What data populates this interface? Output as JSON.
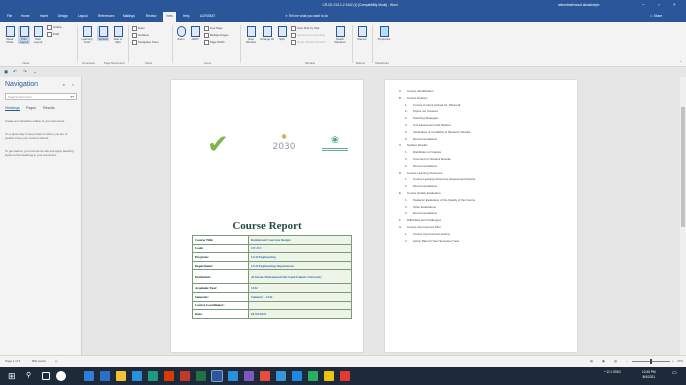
{
  "window": {
    "title": "CR-CE-213-1-2 1442 (1) [Compatibility Mode] - Word",
    "user": "ahmedmahmoud alkutaimiyin",
    "minimize": "–",
    "restore": "▫",
    "close": "×"
  },
  "menu": {
    "tabs": [
      "File",
      "Home",
      "Insert",
      "Design",
      "Layout",
      "References",
      "Mailings",
      "Review",
      "View",
      "Help",
      "ACROBAT"
    ],
    "active_tab": "View",
    "tell_me": "Tell me what you want to do",
    "share": "Share"
  },
  "ribbon": {
    "views": {
      "read": "Read Mode",
      "print": "Print Layout",
      "web": "Web Layout",
      "outline": "Outline",
      "draft": "Draft"
    },
    "immersive": {
      "focus": "Learning Tools",
      "vertical": "Vertical",
      "side": "Side to Side"
    },
    "show": {
      "ruler": "Ruler",
      "gridlines": "Gridlines",
      "nav": "Navigation Pane"
    },
    "zoom": {
      "zoom": "Zoom",
      "hundred": "100%",
      "one": "One Page",
      "multiple": "Multiple Pages",
      "width": "Page Width"
    },
    "window": {
      "new": "New Window",
      "arrange": "Arrange All",
      "split": "Split",
      "side": "View Side by Side",
      "sync": "Synchronous Scrolling",
      "reset": "Reset Window Position",
      "switch": "Switch Windows"
    },
    "macros": "Macros",
    "sharepoint": "Properties",
    "groups": [
      "Views",
      "Immersive",
      "Page Movement",
      "Show",
      "Zoom",
      "Window",
      "Macros",
      "SharePoint"
    ]
  },
  "qat": {
    "save": "▣",
    "undo": "↶",
    "redo": "↷",
    "more": "⌄"
  },
  "nav": {
    "title": "Navigation",
    "search_placeholder": "Search document",
    "tabs": [
      "Headings",
      "Pages",
      "Results"
    ],
    "text1": "Create an interactive outline of your document.",
    "text2": "It's a great way to keep track of where you are or quickly move your content around.",
    "text3": "To get started, go to the Home tab and apply Heading styles to the headings in your document."
  },
  "logos": {
    "check": "✔",
    "vision_year": "2030",
    "vision_mark": "✺",
    "ministry_mark": "❀"
  },
  "report": {
    "title": "Course Report",
    "rows": [
      {
        "k": "Course Title:",
        "v": "Reinforced Concrete Design"
      },
      {
        "k": "Code:",
        "v": "CE 213"
      },
      {
        "k": "Program:",
        "v": "Civil Engineering"
      },
      {
        "k": "Department:",
        "v": "Civil Engineering Department"
      },
      {
        "k": "Institution:",
        "v": "Al Imam Mohammad Ibn Saud Islamic University"
      },
      {
        "k": "Academic Year:",
        "v": "1442"
      },
      {
        "k": "Semester:",
        "v": "Summer - 1442"
      },
      {
        "k": "Course Coordinator:",
        "v": ""
      },
      {
        "k": "Date:",
        "v": "04-08-2021"
      }
    ]
  },
  "toc": [
    {
      "n": "A.",
      "t": "Course Identification",
      "sub": false
    },
    {
      "n": "B.",
      "t": "Course Delivery",
      "sub": false
    },
    {
      "n": "1.",
      "t": "Course Content (Actual Vs. Planned)",
      "sub": true
    },
    {
      "n": "2.",
      "t": "Topics not Covered",
      "sub": true
    },
    {
      "n": "3.",
      "t": "Teaching Strategies",
      "sub": true
    },
    {
      "n": "4.",
      "t": "Unit Assessment and Method",
      "sub": true
    },
    {
      "n": "5.",
      "t": "Verification of Credibility of Students' Results",
      "sub": true
    },
    {
      "n": "6.",
      "t": "Recommendations",
      "sub": true
    },
    {
      "n": "C.",
      "t": "Student Results",
      "sub": false
    },
    {
      "n": "1.",
      "t": "Distribution of Grades",
      "sub": true
    },
    {
      "n": "2.",
      "t": "Comment on Student Results",
      "sub": true
    },
    {
      "n": "3.",
      "t": "Recommendations",
      "sub": true
    },
    {
      "n": "D.",
      "t": "Course Learning Outcomes",
      "sub": false
    },
    {
      "n": "1.",
      "t": "Course Learning Outcomes Assessment Results",
      "sub": true
    },
    {
      "n": "2.",
      "t": "Recommendations",
      "sub": true
    },
    {
      "n": "E.",
      "t": "Course Quality Evaluation",
      "sub": false
    },
    {
      "n": "1.",
      "t": "Students' Evaluation of the Quality of the Course",
      "sub": true
    },
    {
      "n": "2.",
      "t": "Other Evaluations",
      "sub": true
    },
    {
      "n": "3.",
      "t": "Recommendations",
      "sub": true
    },
    {
      "n": "F.",
      "t": "Difficulties and Challenges",
      "sub": false
    },
    {
      "n": "G.",
      "t": "Course Improvement Plan",
      "sub": false
    },
    {
      "n": "1.",
      "t": "Course Improvement Actions",
      "sub": true
    },
    {
      "n": "2.",
      "t": "Action Plan for Next Semester/ Year",
      "sub": true
    }
  ],
  "status": {
    "page": "Page 1 of 6",
    "words": "800 words",
    "zoom": "70%"
  },
  "taskbar": {
    "start": "⊞",
    "time": "12:45 PM",
    "date": "8/4/2021",
    "tray": "^ ⊡ ◊ ENG"
  }
}
